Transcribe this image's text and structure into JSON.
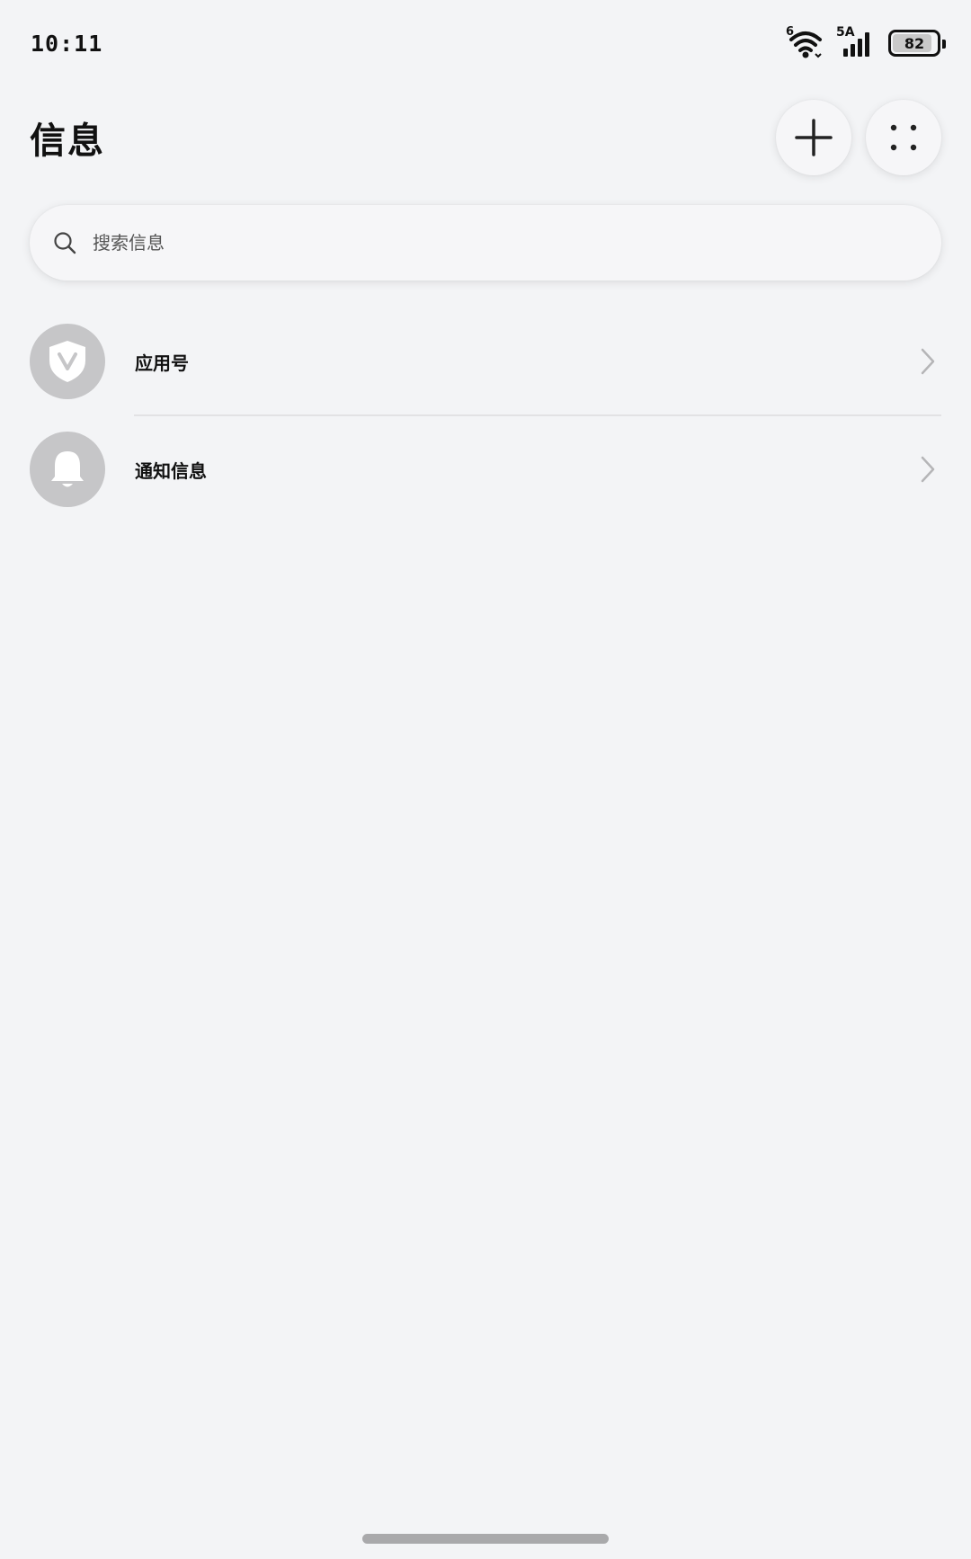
{
  "status_bar": {
    "time": "10:11",
    "wifi_badge": "6",
    "signal_badge": "5A",
    "battery_level": "82"
  },
  "header": {
    "title": "信息",
    "add_icon": "plus-icon",
    "more_icon": "dots-icon"
  },
  "search": {
    "placeholder": "搜索信息",
    "icon": "search-icon"
  },
  "list": {
    "items": [
      {
        "label": "应用号",
        "icon": "shield-v-icon"
      },
      {
        "label": "通知信息",
        "icon": "bell-icon"
      }
    ]
  },
  "colors": {
    "background": "#f3f4f6",
    "avatar_bg": "#c6c6c8",
    "text": "#111111"
  }
}
